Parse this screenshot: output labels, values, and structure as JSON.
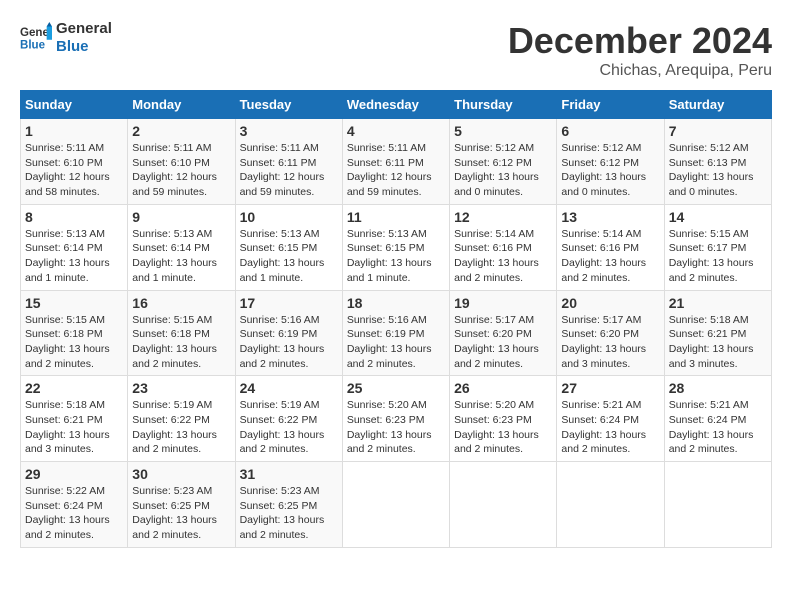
{
  "logo": {
    "line1": "General",
    "line2": "Blue"
  },
  "title": "December 2024",
  "subtitle": "Chichas, Arequipa, Peru",
  "weekdays": [
    "Sunday",
    "Monday",
    "Tuesday",
    "Wednesday",
    "Thursday",
    "Friday",
    "Saturday"
  ],
  "weeks": [
    [
      {
        "day": "1",
        "info": "Sunrise: 5:11 AM\nSunset: 6:10 PM\nDaylight: 12 hours\nand 58 minutes."
      },
      {
        "day": "2",
        "info": "Sunrise: 5:11 AM\nSunset: 6:10 PM\nDaylight: 12 hours\nand 59 minutes."
      },
      {
        "day": "3",
        "info": "Sunrise: 5:11 AM\nSunset: 6:11 PM\nDaylight: 12 hours\nand 59 minutes."
      },
      {
        "day": "4",
        "info": "Sunrise: 5:11 AM\nSunset: 6:11 PM\nDaylight: 12 hours\nand 59 minutes."
      },
      {
        "day": "5",
        "info": "Sunrise: 5:12 AM\nSunset: 6:12 PM\nDaylight: 13 hours\nand 0 minutes."
      },
      {
        "day": "6",
        "info": "Sunrise: 5:12 AM\nSunset: 6:12 PM\nDaylight: 13 hours\nand 0 minutes."
      },
      {
        "day": "7",
        "info": "Sunrise: 5:12 AM\nSunset: 6:13 PM\nDaylight: 13 hours\nand 0 minutes."
      }
    ],
    [
      {
        "day": "8",
        "info": "Sunrise: 5:13 AM\nSunset: 6:14 PM\nDaylight: 13 hours\nand 1 minute."
      },
      {
        "day": "9",
        "info": "Sunrise: 5:13 AM\nSunset: 6:14 PM\nDaylight: 13 hours\nand 1 minute."
      },
      {
        "day": "10",
        "info": "Sunrise: 5:13 AM\nSunset: 6:15 PM\nDaylight: 13 hours\nand 1 minute."
      },
      {
        "day": "11",
        "info": "Sunrise: 5:13 AM\nSunset: 6:15 PM\nDaylight: 13 hours\nand 1 minute."
      },
      {
        "day": "12",
        "info": "Sunrise: 5:14 AM\nSunset: 6:16 PM\nDaylight: 13 hours\nand 2 minutes."
      },
      {
        "day": "13",
        "info": "Sunrise: 5:14 AM\nSunset: 6:16 PM\nDaylight: 13 hours\nand 2 minutes."
      },
      {
        "day": "14",
        "info": "Sunrise: 5:15 AM\nSunset: 6:17 PM\nDaylight: 13 hours\nand 2 minutes."
      }
    ],
    [
      {
        "day": "15",
        "info": "Sunrise: 5:15 AM\nSunset: 6:18 PM\nDaylight: 13 hours\nand 2 minutes."
      },
      {
        "day": "16",
        "info": "Sunrise: 5:15 AM\nSunset: 6:18 PM\nDaylight: 13 hours\nand 2 minutes."
      },
      {
        "day": "17",
        "info": "Sunrise: 5:16 AM\nSunset: 6:19 PM\nDaylight: 13 hours\nand 2 minutes."
      },
      {
        "day": "18",
        "info": "Sunrise: 5:16 AM\nSunset: 6:19 PM\nDaylight: 13 hours\nand 2 minutes."
      },
      {
        "day": "19",
        "info": "Sunrise: 5:17 AM\nSunset: 6:20 PM\nDaylight: 13 hours\nand 2 minutes."
      },
      {
        "day": "20",
        "info": "Sunrise: 5:17 AM\nSunset: 6:20 PM\nDaylight: 13 hours\nand 3 minutes."
      },
      {
        "day": "21",
        "info": "Sunrise: 5:18 AM\nSunset: 6:21 PM\nDaylight: 13 hours\nand 3 minutes."
      }
    ],
    [
      {
        "day": "22",
        "info": "Sunrise: 5:18 AM\nSunset: 6:21 PM\nDaylight: 13 hours\nand 3 minutes."
      },
      {
        "day": "23",
        "info": "Sunrise: 5:19 AM\nSunset: 6:22 PM\nDaylight: 13 hours\nand 2 minutes."
      },
      {
        "day": "24",
        "info": "Sunrise: 5:19 AM\nSunset: 6:22 PM\nDaylight: 13 hours\nand 2 minutes."
      },
      {
        "day": "25",
        "info": "Sunrise: 5:20 AM\nSunset: 6:23 PM\nDaylight: 13 hours\nand 2 minutes."
      },
      {
        "day": "26",
        "info": "Sunrise: 5:20 AM\nSunset: 6:23 PM\nDaylight: 13 hours\nand 2 minutes."
      },
      {
        "day": "27",
        "info": "Sunrise: 5:21 AM\nSunset: 6:24 PM\nDaylight: 13 hours\nand 2 minutes."
      },
      {
        "day": "28",
        "info": "Sunrise: 5:21 AM\nSunset: 6:24 PM\nDaylight: 13 hours\nand 2 minutes."
      }
    ],
    [
      {
        "day": "29",
        "info": "Sunrise: 5:22 AM\nSunset: 6:24 PM\nDaylight: 13 hours\nand 2 minutes."
      },
      {
        "day": "30",
        "info": "Sunrise: 5:23 AM\nSunset: 6:25 PM\nDaylight: 13 hours\nand 2 minutes."
      },
      {
        "day": "31",
        "info": "Sunrise: 5:23 AM\nSunset: 6:25 PM\nDaylight: 13 hours\nand 2 minutes."
      },
      {
        "day": "",
        "info": ""
      },
      {
        "day": "",
        "info": ""
      },
      {
        "day": "",
        "info": ""
      },
      {
        "day": "",
        "info": ""
      }
    ]
  ]
}
